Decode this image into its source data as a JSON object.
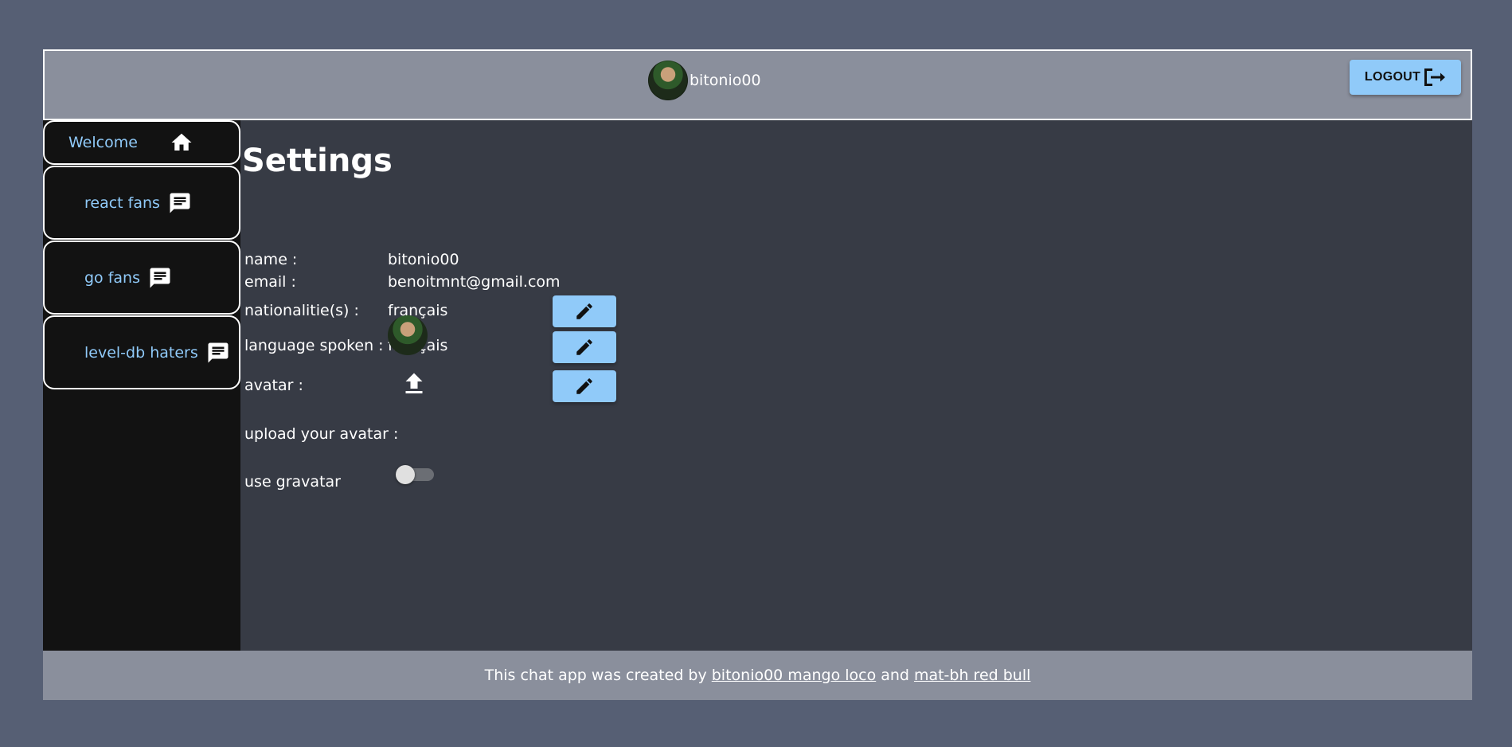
{
  "header": {
    "username": "bitonio00",
    "logout_label": "LOGOUT",
    "avatar_icon": "avatar-image",
    "logout_icon": "logout-icon"
  },
  "sidebar": {
    "items": [
      {
        "label": "Welcome",
        "icon": "home-icon"
      },
      {
        "label": "react fans",
        "icon": "chat-icon"
      },
      {
        "label": "go fans",
        "icon": "chat-icon"
      },
      {
        "label": "level-db haters",
        "icon": "chat-icon"
      }
    ]
  },
  "settings": {
    "title": "Settings",
    "name_label": "name :",
    "name_value": "bitonio00",
    "email_label": "email :",
    "email_value": "benoitmnt@gmail.com",
    "nationality_label": "nationalitie(s) :",
    "nationality_value": "français",
    "language_label": "language spoken :",
    "language_value": "français",
    "avatar_label": "avatar :",
    "upload_label": "upload your avatar :",
    "gravatar_label": "use gravatar",
    "gravatar_enabled": false
  },
  "footer": {
    "prefix": "This chat app was created by",
    "link1": "bitonio00 mango loco",
    "joiner": "and",
    "link2": "mat-bh red bull"
  },
  "colors": {
    "accent": "#90caf9",
    "page_bg": "#565f74",
    "main_bg": "#373b45",
    "sidebar_bg": "#121212",
    "header_bg": "#8a8f9c"
  }
}
